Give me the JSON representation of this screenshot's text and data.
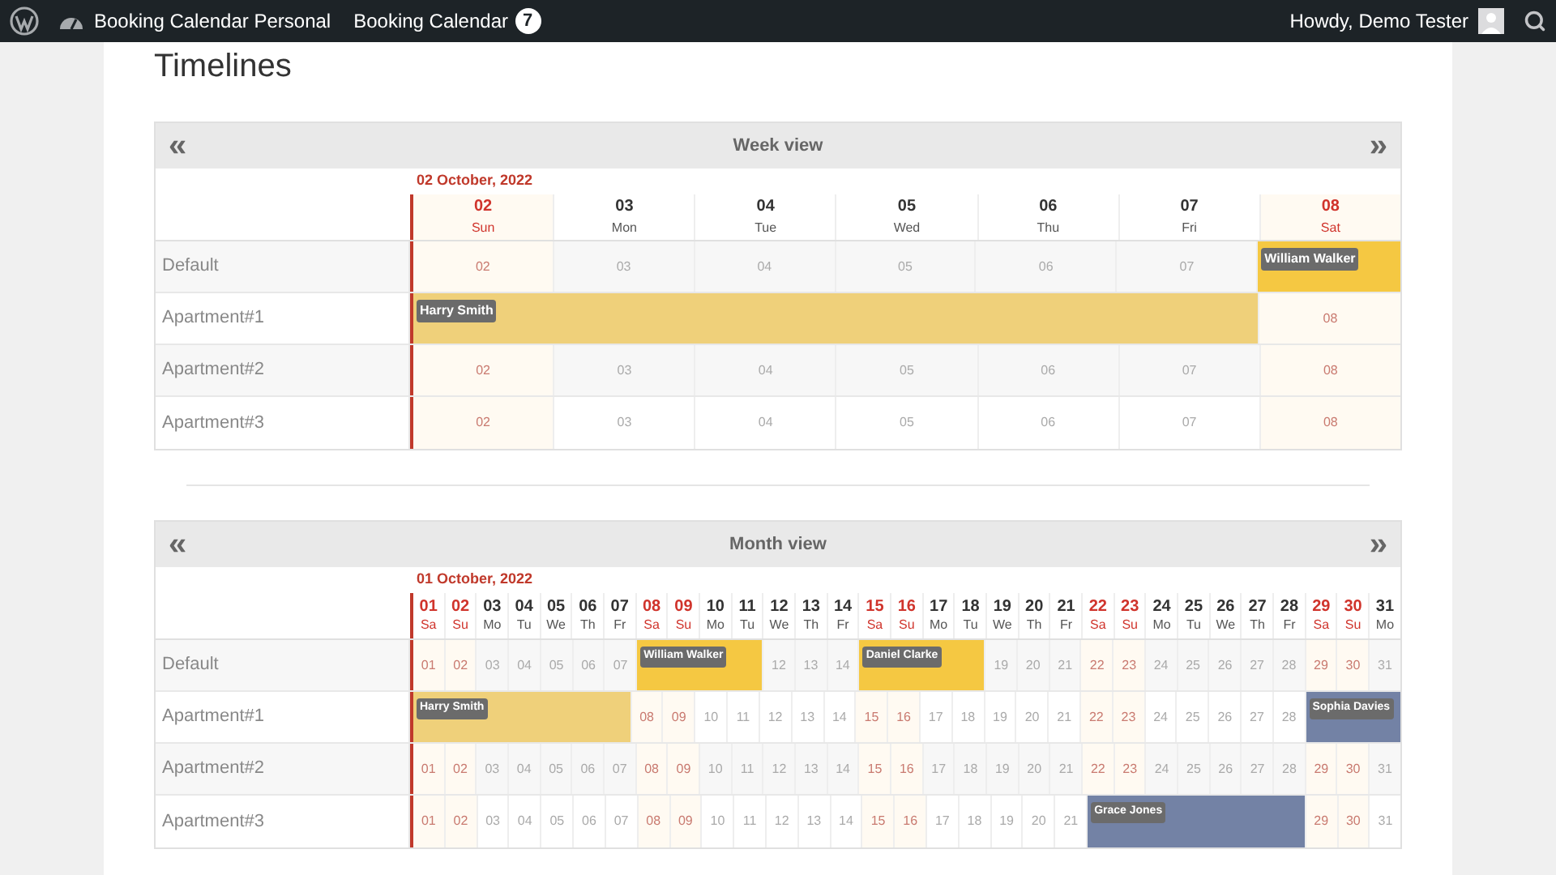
{
  "admin_bar": {
    "site": "Booking Calendar Personal",
    "plugin": "Booking Calendar",
    "badge": "7",
    "greeting": "Howdy, Demo Tester"
  },
  "page_title": "Timelines",
  "timelines": [
    {
      "title": "Week view",
      "prev": "«",
      "next": "»",
      "date_label": "02 October, 2022",
      "days": [
        {
          "day": "02",
          "weekday": "Sun",
          "weekend": true,
          "today": true
        },
        {
          "day": "03",
          "weekday": "Mon",
          "weekend": false,
          "today": false
        },
        {
          "day": "04",
          "weekday": "Tue",
          "weekend": false,
          "today": false
        },
        {
          "day": "05",
          "weekday": "Wed",
          "weekend": false,
          "today": false
        },
        {
          "day": "06",
          "weekday": "Thu",
          "weekend": false,
          "today": false
        },
        {
          "day": "07",
          "weekday": "Fri",
          "weekend": false,
          "today": false
        },
        {
          "day": "08",
          "weekday": "Sat",
          "weekend": true,
          "today": false
        }
      ],
      "rows": [
        {
          "name": "Default",
          "cells": [
            {
              "kind": "day",
              "text": "02"
            },
            {
              "kind": "day",
              "text": "03"
            },
            {
              "kind": "day",
              "text": "04"
            },
            {
              "kind": "day",
              "text": "05"
            },
            {
              "kind": "day",
              "text": "06"
            },
            {
              "kind": "day",
              "text": "07"
            },
            {
              "kind": "booked",
              "color": "#f5c842",
              "guest": "William Walker"
            }
          ]
        },
        {
          "name": "Apartment#1",
          "cells": [
            {
              "kind": "booked",
              "color": "#efd07a",
              "guest": "Harry Smith"
            },
            {
              "kind": "booked"
            },
            {
              "kind": "booked"
            },
            {
              "kind": "booked"
            },
            {
              "kind": "booked"
            },
            {
              "kind": "booked"
            },
            {
              "kind": "day",
              "text": "08"
            }
          ]
        },
        {
          "name": "Apartment#2",
          "cells": [
            {
              "kind": "day",
              "text": "02"
            },
            {
              "kind": "day",
              "text": "03"
            },
            {
              "kind": "day",
              "text": "04"
            },
            {
              "kind": "day",
              "text": "05"
            },
            {
              "kind": "day",
              "text": "06"
            },
            {
              "kind": "day",
              "text": "07"
            },
            {
              "kind": "day",
              "text": "08"
            }
          ]
        },
        {
          "name": "Apartment#3",
          "cells": [
            {
              "kind": "day",
              "text": "02"
            },
            {
              "kind": "day",
              "text": "03"
            },
            {
              "kind": "day",
              "text": "04"
            },
            {
              "kind": "day",
              "text": "05"
            },
            {
              "kind": "day",
              "text": "06"
            },
            {
              "kind": "day",
              "text": "07"
            },
            {
              "kind": "day",
              "text": "08"
            }
          ]
        }
      ]
    },
    {
      "title": "Month view",
      "prev": "«",
      "next": "»",
      "date_label": "01 October, 2022",
      "days": [
        {
          "day": "01",
          "weekday": "Sa",
          "weekend": true,
          "today": true
        },
        {
          "day": "02",
          "weekday": "Su",
          "weekend": true,
          "today": false
        },
        {
          "day": "03",
          "weekday": "Mo",
          "weekend": false,
          "today": false
        },
        {
          "day": "04",
          "weekday": "Tu",
          "weekend": false,
          "today": false
        },
        {
          "day": "05",
          "weekday": "We",
          "weekend": false,
          "today": false
        },
        {
          "day": "06",
          "weekday": "Th",
          "weekend": false,
          "today": false
        },
        {
          "day": "07",
          "weekday": "Fr",
          "weekend": false,
          "today": false
        },
        {
          "day": "08",
          "weekday": "Sa",
          "weekend": true,
          "today": false
        },
        {
          "day": "09",
          "weekday": "Su",
          "weekend": true,
          "today": false
        },
        {
          "day": "10",
          "weekday": "Mo",
          "weekend": false,
          "today": false
        },
        {
          "day": "11",
          "weekday": "Tu",
          "weekend": false,
          "today": false
        },
        {
          "day": "12",
          "weekday": "We",
          "weekend": false,
          "today": false
        },
        {
          "day": "13",
          "weekday": "Th",
          "weekend": false,
          "today": false
        },
        {
          "day": "14",
          "weekday": "Fr",
          "weekend": false,
          "today": false
        },
        {
          "day": "15",
          "weekday": "Sa",
          "weekend": true,
          "today": false
        },
        {
          "day": "16",
          "weekday": "Su",
          "weekend": true,
          "today": false
        },
        {
          "day": "17",
          "weekday": "Mo",
          "weekend": false,
          "today": false
        },
        {
          "day": "18",
          "weekday": "Tu",
          "weekend": false,
          "today": false
        },
        {
          "day": "19",
          "weekday": "We",
          "weekend": false,
          "today": false
        },
        {
          "day": "20",
          "weekday": "Th",
          "weekend": false,
          "today": false
        },
        {
          "day": "21",
          "weekday": "Fr",
          "weekend": false,
          "today": false
        },
        {
          "day": "22",
          "weekday": "Sa",
          "weekend": true,
          "today": false
        },
        {
          "day": "23",
          "weekday": "Su",
          "weekend": true,
          "today": false
        },
        {
          "day": "24",
          "weekday": "Mo",
          "weekend": false,
          "today": false
        },
        {
          "day": "25",
          "weekday": "Tu",
          "weekend": false,
          "today": false
        },
        {
          "day": "26",
          "weekday": "We",
          "weekend": false,
          "today": false
        },
        {
          "day": "27",
          "weekday": "Th",
          "weekend": false,
          "today": false
        },
        {
          "day": "28",
          "weekday": "Fr",
          "weekend": false,
          "today": false
        },
        {
          "day": "29",
          "weekday": "Sa",
          "weekend": true,
          "today": false
        },
        {
          "day": "30",
          "weekday": "Su",
          "weekend": true,
          "today": false
        },
        {
          "day": "31",
          "weekday": "Mo",
          "weekend": false,
          "today": false
        }
      ],
      "rows": [
        {
          "name": "Default",
          "cells": [
            {
              "kind": "day",
              "text": "01"
            },
            {
              "kind": "day",
              "text": "02"
            },
            {
              "kind": "day",
              "text": "03"
            },
            {
              "kind": "day",
              "text": "04"
            },
            {
              "kind": "day",
              "text": "05"
            },
            {
              "kind": "day",
              "text": "06"
            },
            {
              "kind": "day",
              "text": "07"
            },
            {
              "kind": "booked",
              "color": "#f5c842",
              "guest": "William Walker"
            },
            {
              "kind": "booked"
            },
            {
              "kind": "booked"
            },
            {
              "kind": "booked"
            },
            {
              "kind": "day",
              "text": "12"
            },
            {
              "kind": "day",
              "text": "13"
            },
            {
              "kind": "day",
              "text": "14"
            },
            {
              "kind": "booked",
              "color": "#f5c842",
              "guest": "Daniel Clarke"
            },
            {
              "kind": "booked"
            },
            {
              "kind": "booked"
            },
            {
              "kind": "booked"
            },
            {
              "kind": "day",
              "text": "19"
            },
            {
              "kind": "day",
              "text": "20"
            },
            {
              "kind": "day",
              "text": "21"
            },
            {
              "kind": "day",
              "text": "22"
            },
            {
              "kind": "day",
              "text": "23"
            },
            {
              "kind": "day",
              "text": "24"
            },
            {
              "kind": "day",
              "text": "25"
            },
            {
              "kind": "day",
              "text": "26"
            },
            {
              "kind": "day",
              "text": "27"
            },
            {
              "kind": "day",
              "text": "28"
            },
            {
              "kind": "day",
              "text": "29"
            },
            {
              "kind": "day",
              "text": "30"
            },
            {
              "kind": "day",
              "text": "31"
            }
          ]
        },
        {
          "name": "Apartment#1",
          "cells": [
            {
              "kind": "booked",
              "color": "#efd07a",
              "guest": "Harry Smith"
            },
            {
              "kind": "booked"
            },
            {
              "kind": "booked"
            },
            {
              "kind": "booked"
            },
            {
              "kind": "booked"
            },
            {
              "kind": "booked"
            },
            {
              "kind": "booked"
            },
            {
              "kind": "day",
              "text": "08"
            },
            {
              "kind": "day",
              "text": "09"
            },
            {
              "kind": "day",
              "text": "10"
            },
            {
              "kind": "day",
              "text": "11"
            },
            {
              "kind": "day",
              "text": "12"
            },
            {
              "kind": "day",
              "text": "13"
            },
            {
              "kind": "day",
              "text": "14"
            },
            {
              "kind": "day",
              "text": "15"
            },
            {
              "kind": "day",
              "text": "16"
            },
            {
              "kind": "day",
              "text": "17"
            },
            {
              "kind": "day",
              "text": "18"
            },
            {
              "kind": "day",
              "text": "19"
            },
            {
              "kind": "day",
              "text": "20"
            },
            {
              "kind": "day",
              "text": "21"
            },
            {
              "kind": "day",
              "text": "22"
            },
            {
              "kind": "day",
              "text": "23"
            },
            {
              "kind": "day",
              "text": "24"
            },
            {
              "kind": "day",
              "text": "25"
            },
            {
              "kind": "day",
              "text": "26"
            },
            {
              "kind": "day",
              "text": "27"
            },
            {
              "kind": "day",
              "text": "28"
            },
            {
              "kind": "booked",
              "color": "#7382a5",
              "guest": "Sophia Davies"
            },
            {
              "kind": "booked"
            },
            {
              "kind": "booked"
            }
          ]
        },
        {
          "name": "Apartment#2",
          "cells": [
            {
              "kind": "day",
              "text": "01"
            },
            {
              "kind": "day",
              "text": "02"
            },
            {
              "kind": "day",
              "text": "03"
            },
            {
              "kind": "day",
              "text": "04"
            },
            {
              "kind": "day",
              "text": "05"
            },
            {
              "kind": "day",
              "text": "06"
            },
            {
              "kind": "day",
              "text": "07"
            },
            {
              "kind": "day",
              "text": "08"
            },
            {
              "kind": "day",
              "text": "09"
            },
            {
              "kind": "day",
              "text": "10"
            },
            {
              "kind": "day",
              "text": "11"
            },
            {
              "kind": "day",
              "text": "12"
            },
            {
              "kind": "day",
              "text": "13"
            },
            {
              "kind": "day",
              "text": "14"
            },
            {
              "kind": "day",
              "text": "15"
            },
            {
              "kind": "day",
              "text": "16"
            },
            {
              "kind": "day",
              "text": "17"
            },
            {
              "kind": "day",
              "text": "18"
            },
            {
              "kind": "day",
              "text": "19"
            },
            {
              "kind": "day",
              "text": "20"
            },
            {
              "kind": "day",
              "text": "21"
            },
            {
              "kind": "day",
              "text": "22"
            },
            {
              "kind": "day",
              "text": "23"
            },
            {
              "kind": "day",
              "text": "24"
            },
            {
              "kind": "day",
              "text": "25"
            },
            {
              "kind": "day",
              "text": "26"
            },
            {
              "kind": "day",
              "text": "27"
            },
            {
              "kind": "day",
              "text": "28"
            },
            {
              "kind": "day",
              "text": "29"
            },
            {
              "kind": "day",
              "text": "30"
            },
            {
              "kind": "day",
              "text": "31"
            }
          ]
        },
        {
          "name": "Apartment#3",
          "cells": [
            {
              "kind": "day",
              "text": "01"
            },
            {
              "kind": "day",
              "text": "02"
            },
            {
              "kind": "day",
              "text": "03"
            },
            {
              "kind": "day",
              "text": "04"
            },
            {
              "kind": "day",
              "text": "05"
            },
            {
              "kind": "day",
              "text": "06"
            },
            {
              "kind": "day",
              "text": "07"
            },
            {
              "kind": "day",
              "text": "08"
            },
            {
              "kind": "day",
              "text": "09"
            },
            {
              "kind": "day",
              "text": "10"
            },
            {
              "kind": "day",
              "text": "11"
            },
            {
              "kind": "day",
              "text": "12"
            },
            {
              "kind": "day",
              "text": "13"
            },
            {
              "kind": "day",
              "text": "14"
            },
            {
              "kind": "day",
              "text": "15"
            },
            {
              "kind": "day",
              "text": "16"
            },
            {
              "kind": "day",
              "text": "17"
            },
            {
              "kind": "day",
              "text": "18"
            },
            {
              "kind": "day",
              "text": "19"
            },
            {
              "kind": "day",
              "text": "20"
            },
            {
              "kind": "day",
              "text": "21"
            },
            {
              "kind": "booked",
              "color": "#7382a5",
              "guest": "Grace Jones"
            },
            {
              "kind": "booked"
            },
            {
              "kind": "booked"
            },
            {
              "kind": "booked"
            },
            {
              "kind": "booked"
            },
            {
              "kind": "booked"
            },
            {
              "kind": "booked"
            },
            {
              "kind": "day",
              "text": "29"
            },
            {
              "kind": "day",
              "text": "30"
            },
            {
              "kind": "day",
              "text": "31"
            }
          ]
        }
      ]
    }
  ]
}
